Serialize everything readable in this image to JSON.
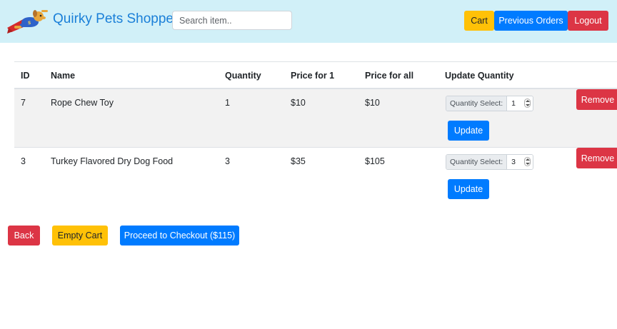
{
  "navbar": {
    "brand": "Quirky Pets Shoppe",
    "search_placeholder": "Search item..",
    "cart_label": "Cart",
    "previous_orders_label": "Previous Orders",
    "logout_label": "Logout"
  },
  "table": {
    "headers": [
      "ID",
      "Name",
      "Quantity",
      "Price for 1",
      "Price for all",
      "Update Quantity"
    ],
    "quantity_select_label": "Quantity Select:",
    "update_label": "Update",
    "remove_label": "Remove",
    "rows": [
      {
        "id": "7",
        "name": "Rope Chew Toy",
        "quantity": "1",
        "price_one": "$10",
        "price_all": "$10",
        "quantity_value": "1"
      },
      {
        "id": "3",
        "name": "Turkey Flavored Dry Dog Food",
        "quantity": "3",
        "price_one": "$35",
        "price_all": "$105",
        "quantity_value": "3"
      }
    ]
  },
  "actions": {
    "back_label": "Back",
    "empty_cart_label": "Empty Cart",
    "checkout_label": "Proceed to Checkout ($115)"
  },
  "colors": {
    "navbar_bg": "#d1f0f8",
    "brand": "#1a7fd8",
    "primary": "#007bff",
    "warning": "#ffc107",
    "danger": "#dc3545",
    "striped_row": "#f2f2f2"
  },
  "icons": {
    "logo": "superhero-dog-logo-icon"
  }
}
